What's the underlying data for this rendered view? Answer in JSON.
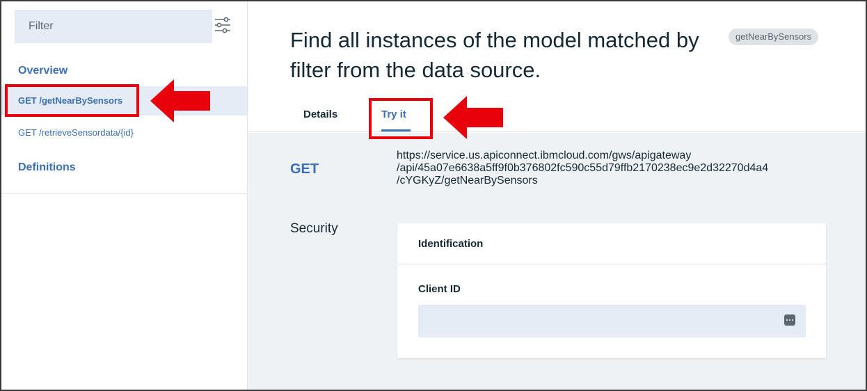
{
  "sidebar": {
    "filter_placeholder": "Filter",
    "overview_label": "Overview",
    "items": [
      {
        "label": "GET /getNearBySensors",
        "active": true
      },
      {
        "label": "GET /retrieveSensordata/{id}",
        "active": false
      }
    ],
    "definitions_label": "Definitions"
  },
  "operation": {
    "title": "Find all instances of the model matched by filter from the data source.",
    "operation_id": "getNearBySensors"
  },
  "tabs": [
    {
      "label": "Details",
      "active": false
    },
    {
      "label": "Try it",
      "active": true
    }
  ],
  "request": {
    "method": "GET",
    "url_lines": [
      "https://service.us.apiconnect.ibmcloud.com/gws/apigateway",
      "/api/45a07e6638a5ff9f0b376802fc590c55d79ffb2170238ec9e2d32270d4a4",
      "/cYGKyZ/getNearBySensors"
    ]
  },
  "security": {
    "label": "Security",
    "card_title": "Identification",
    "client_id_label": "Client ID",
    "client_id_value": ""
  },
  "annotations": {
    "highlight_color": "#e8000b"
  },
  "icons": {
    "filter": "sliders-icon",
    "field_menu": "more-dots-icon",
    "callout": "arrow-left-icon"
  }
}
